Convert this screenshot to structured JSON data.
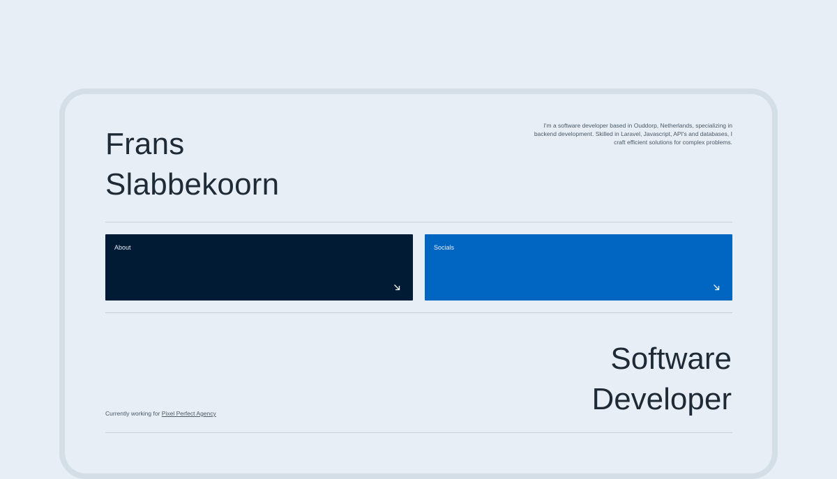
{
  "profile": {
    "name_line1": "Frans",
    "name_line2": "Slabbekoorn",
    "bio": "I'm a software developer based in Ouddorp, Netherlands, specializing in backend development. Skilled in Laravel, Javascript, API's and databases, I craft efficient solutions for complex problems."
  },
  "cards": {
    "about": {
      "label": "About",
      "color": "#021b35",
      "icon": "arrow-down-right-icon"
    },
    "socials": {
      "label": "Socials",
      "color": "#0066c2",
      "icon": "arrow-down-right-icon"
    }
  },
  "role": {
    "line1": "Software",
    "line2": "Developer"
  },
  "work": {
    "prefix": "Currently working for",
    "company": "Pixel Perfect Agency"
  }
}
